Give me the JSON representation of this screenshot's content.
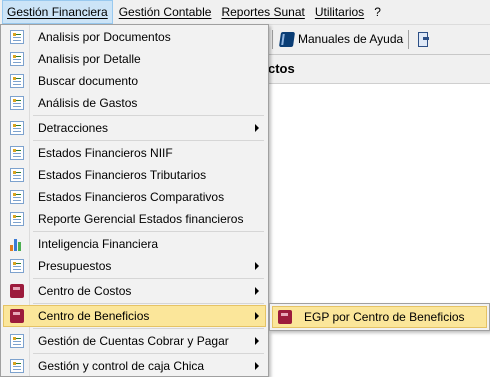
{
  "menubar": {
    "items": [
      {
        "label": "Gestión Financiera"
      },
      {
        "label": "Gestión Contable"
      },
      {
        "label": "Reportes Sunat"
      },
      {
        "label": "Utilitarios"
      },
      {
        "label": "?"
      }
    ]
  },
  "toolbar": {
    "manual_label": "Manuales de Ayuda"
  },
  "window": {
    "title_fragment": "ctos"
  },
  "dropdown": {
    "items": [
      {
        "label": "Analisis por Documentos",
        "icon": "doc-icon"
      },
      {
        "label": "Analisis por Detalle",
        "icon": "doc-icon"
      },
      {
        "label": "Buscar documento",
        "icon": "doc-icon"
      },
      {
        "label": "Análisis de Gastos",
        "icon": "doc-icon"
      },
      {
        "label": "Detracciones",
        "icon": "doc-icon",
        "submenu": true
      },
      {
        "label": "Estados Financieros NIIF",
        "icon": "doc-icon"
      },
      {
        "label": "Estados Financieros Tributarios",
        "icon": "doc-icon"
      },
      {
        "label": "Estados Financieros Comparativos",
        "icon": "doc-icon"
      },
      {
        "label": "Reporte Gerencial Estados financieros",
        "icon": "doc-icon"
      },
      {
        "label": "Inteligencia Financiera",
        "icon": "bar-chart-icon"
      },
      {
        "label": "Presupuestos",
        "icon": "doc-icon",
        "submenu": true
      },
      {
        "label": "Centro de Costos",
        "icon": "book-icon",
        "submenu": true
      },
      {
        "label": "Centro de Beneficios",
        "icon": "book-icon",
        "submenu": true,
        "highlighted": true
      },
      {
        "label": "Gestión de Cuentas Cobrar y Pagar",
        "icon": "doc-icon",
        "submenu": true
      },
      {
        "label": "Gestión y control de caja Chica",
        "icon": "doc-icon",
        "submenu": true
      }
    ]
  },
  "submenu": {
    "items": [
      {
        "label": "EGP por Centro de Beneficios",
        "icon": "book-icon",
        "highlighted": true
      }
    ]
  },
  "colors": {
    "highlight": "#fbe69a",
    "highlight_border": "#e5c365",
    "menu_bg": "#f2f2f2",
    "active_menu": "#cce4f7"
  }
}
